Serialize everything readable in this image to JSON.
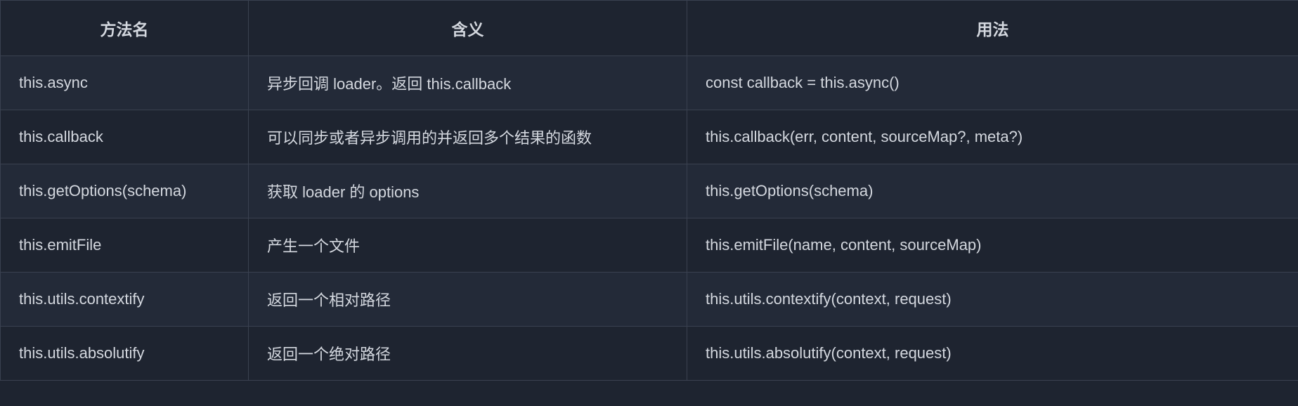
{
  "table": {
    "headers": [
      "方法名",
      "含义",
      "用法"
    ],
    "rows": [
      {
        "method": "this.async",
        "meaning": "异步回调 loader。返回 this.callback",
        "usage": "const callback = this.async()"
      },
      {
        "method": "this.callback",
        "meaning": "可以同步或者异步调用的并返回多个结果的函数",
        "usage": "this.callback(err, content, sourceMap?, meta?)"
      },
      {
        "method": "this.getOptions(schema)",
        "meaning": "获取 loader 的 options",
        "usage": "this.getOptions(schema)"
      },
      {
        "method": "this.emitFile",
        "meaning": "产生一个文件",
        "usage": "this.emitFile(name, content, sourceMap)"
      },
      {
        "method": "this.utils.contextify",
        "meaning": "返回一个相对路径",
        "usage": "this.utils.contextify(context, request)"
      },
      {
        "method": "this.utils.absolutify",
        "meaning": "返回一个绝对路径",
        "usage": "this.utils.absolutify(context, request)"
      }
    ]
  }
}
